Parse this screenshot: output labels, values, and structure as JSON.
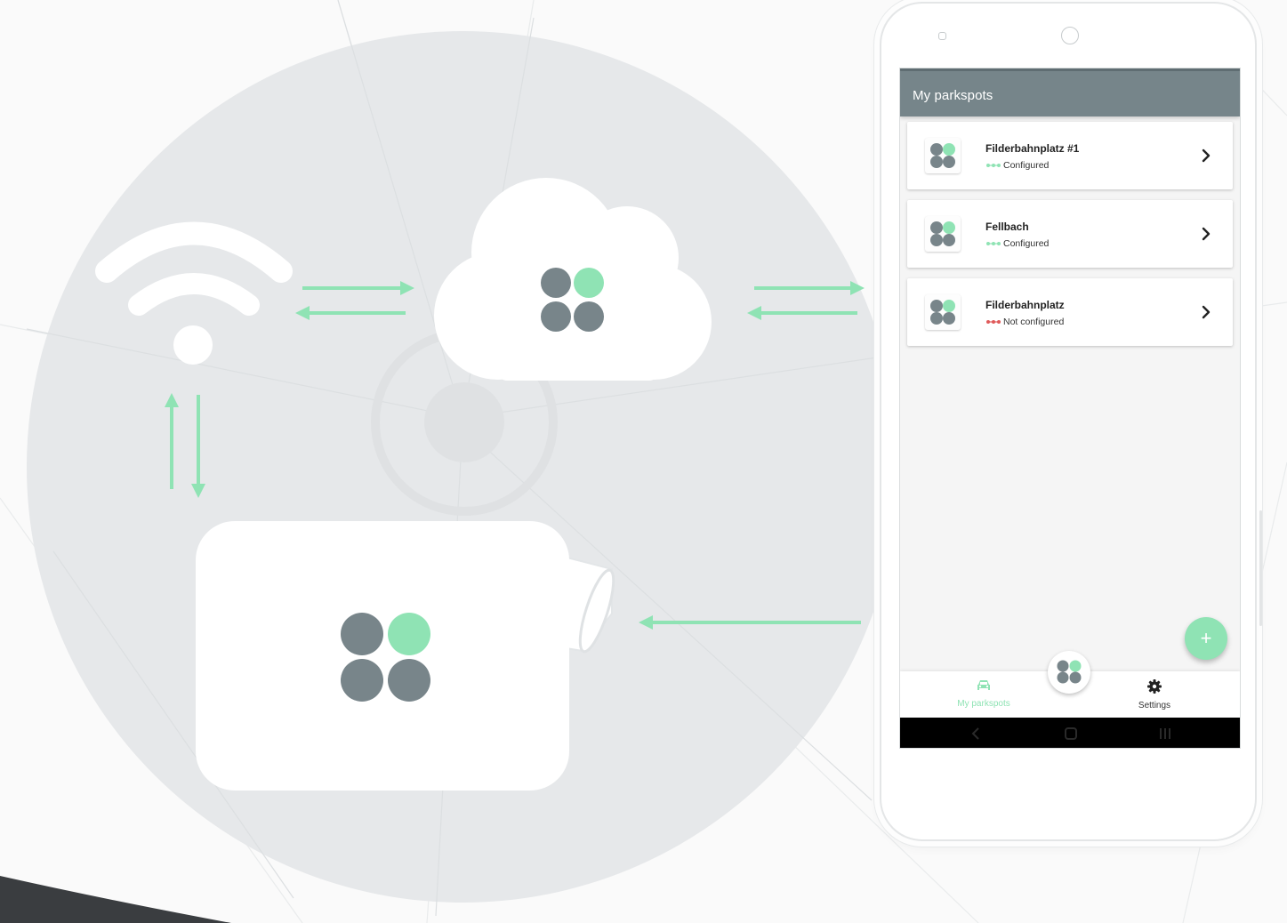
{
  "colors": {
    "accent": "#8fe3b4",
    "logo_gray": "#78858a",
    "app_bar": "#76858a",
    "status_ok": "#8fe3b4",
    "status_error": "#e05a5a",
    "circle_bg": "#e6e8ea"
  },
  "diagram": {
    "icons": [
      "wifi-icon",
      "cloud-icon",
      "camera-device-icon",
      "parkspot-logo-icon"
    ]
  },
  "app": {
    "title": "My parkspots",
    "parkspots": [
      {
        "name": "Filderbahnplatz #1",
        "status": "Configured",
        "status_kind": "ok"
      },
      {
        "name": "Fellbach",
        "status": "Configured",
        "status_kind": "ok"
      },
      {
        "name": "Filderbahnplatz",
        "status": "Not configured",
        "status_kind": "error"
      }
    ],
    "fab_icon": "+",
    "nav": {
      "parkspots_label": "My parkspots",
      "settings_label": "Settings"
    }
  }
}
